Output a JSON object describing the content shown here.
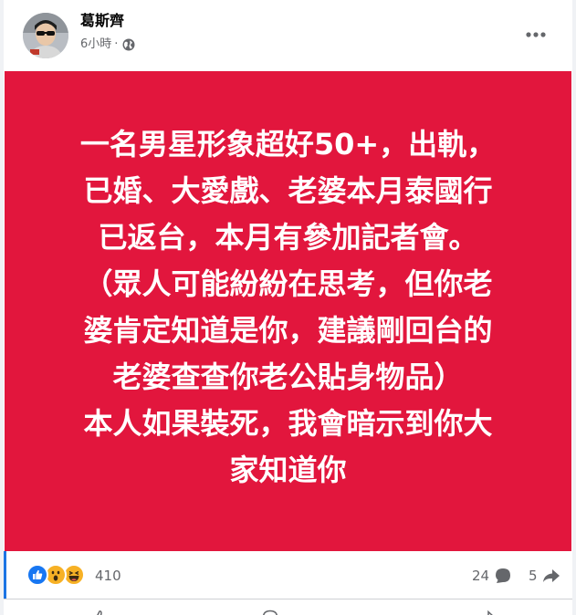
{
  "post": {
    "author": "葛斯齊",
    "time": "6小時",
    "separator": "·",
    "privacy_icon": "globe-icon",
    "body": "一名男星形象超好50+，出軌，\n已婚、大愛戲、老婆本月泰國行\n已返台，本月有參加記者會。\n（眾人可能紛紛在思考，但你老\n婆肯定知道是你，建議剛回台的\n老婆查查你老公貼身物品）\n本人如果裝死，我會暗示到你大\n家知道你",
    "background_color": "#e2163d"
  },
  "stats": {
    "reaction_icons": [
      "like-icon",
      "wow-icon",
      "haha-icon"
    ],
    "reaction_count": "410",
    "comment_count": "24",
    "share_count": "5"
  },
  "colors": {
    "accent": "#1b74e4",
    "secondary_text": "#65676b"
  }
}
